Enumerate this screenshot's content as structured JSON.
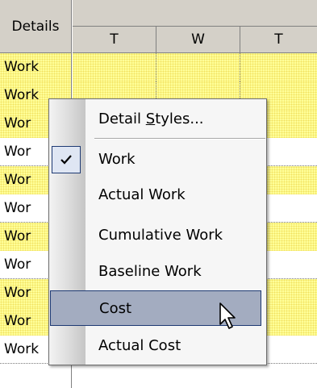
{
  "grid": {
    "details_header": "Details",
    "day_headers": [
      "T",
      "W",
      "T"
    ],
    "rows": [
      {
        "label": "Work",
        "highlighted": true
      },
      {
        "label": "Work",
        "highlighted": true
      },
      {
        "label": "Wor",
        "highlighted": true
      },
      {
        "label": "Wor",
        "highlighted": false
      },
      {
        "label": "Wor",
        "highlighted": true
      },
      {
        "label": "Wor",
        "highlighted": false
      },
      {
        "label": "Wor",
        "highlighted": true
      },
      {
        "label": "Wor",
        "highlighted": false
      },
      {
        "label": "Wor",
        "highlighted": true
      },
      {
        "label": "Wor",
        "highlighted": true
      },
      {
        "label": "Work",
        "highlighted": false
      }
    ]
  },
  "context_menu": {
    "detail_styles": {
      "before": "Detail ",
      "mnemonic": "S",
      "after": "tyles..."
    },
    "items": [
      {
        "label": "Work",
        "checked": true,
        "selected": false
      },
      {
        "label": "Actual Work",
        "checked": false,
        "selected": false
      },
      {
        "label": "Cumulative Work",
        "checked": false,
        "selected": false
      },
      {
        "label": "Baseline Work",
        "checked": false,
        "selected": false
      },
      {
        "label": "Cost",
        "checked": false,
        "selected": true
      },
      {
        "label": "Actual Cost",
        "checked": false,
        "selected": false
      }
    ],
    "check_icon": "checkmark-icon",
    "cursor_icon": "mouse-pointer-icon"
  },
  "colors": {
    "highlight_row": "#ffff99",
    "menu_selection": "#a3acc0",
    "menu_selection_border": "#1e3a73",
    "header_bg": "#d4d0c8"
  }
}
